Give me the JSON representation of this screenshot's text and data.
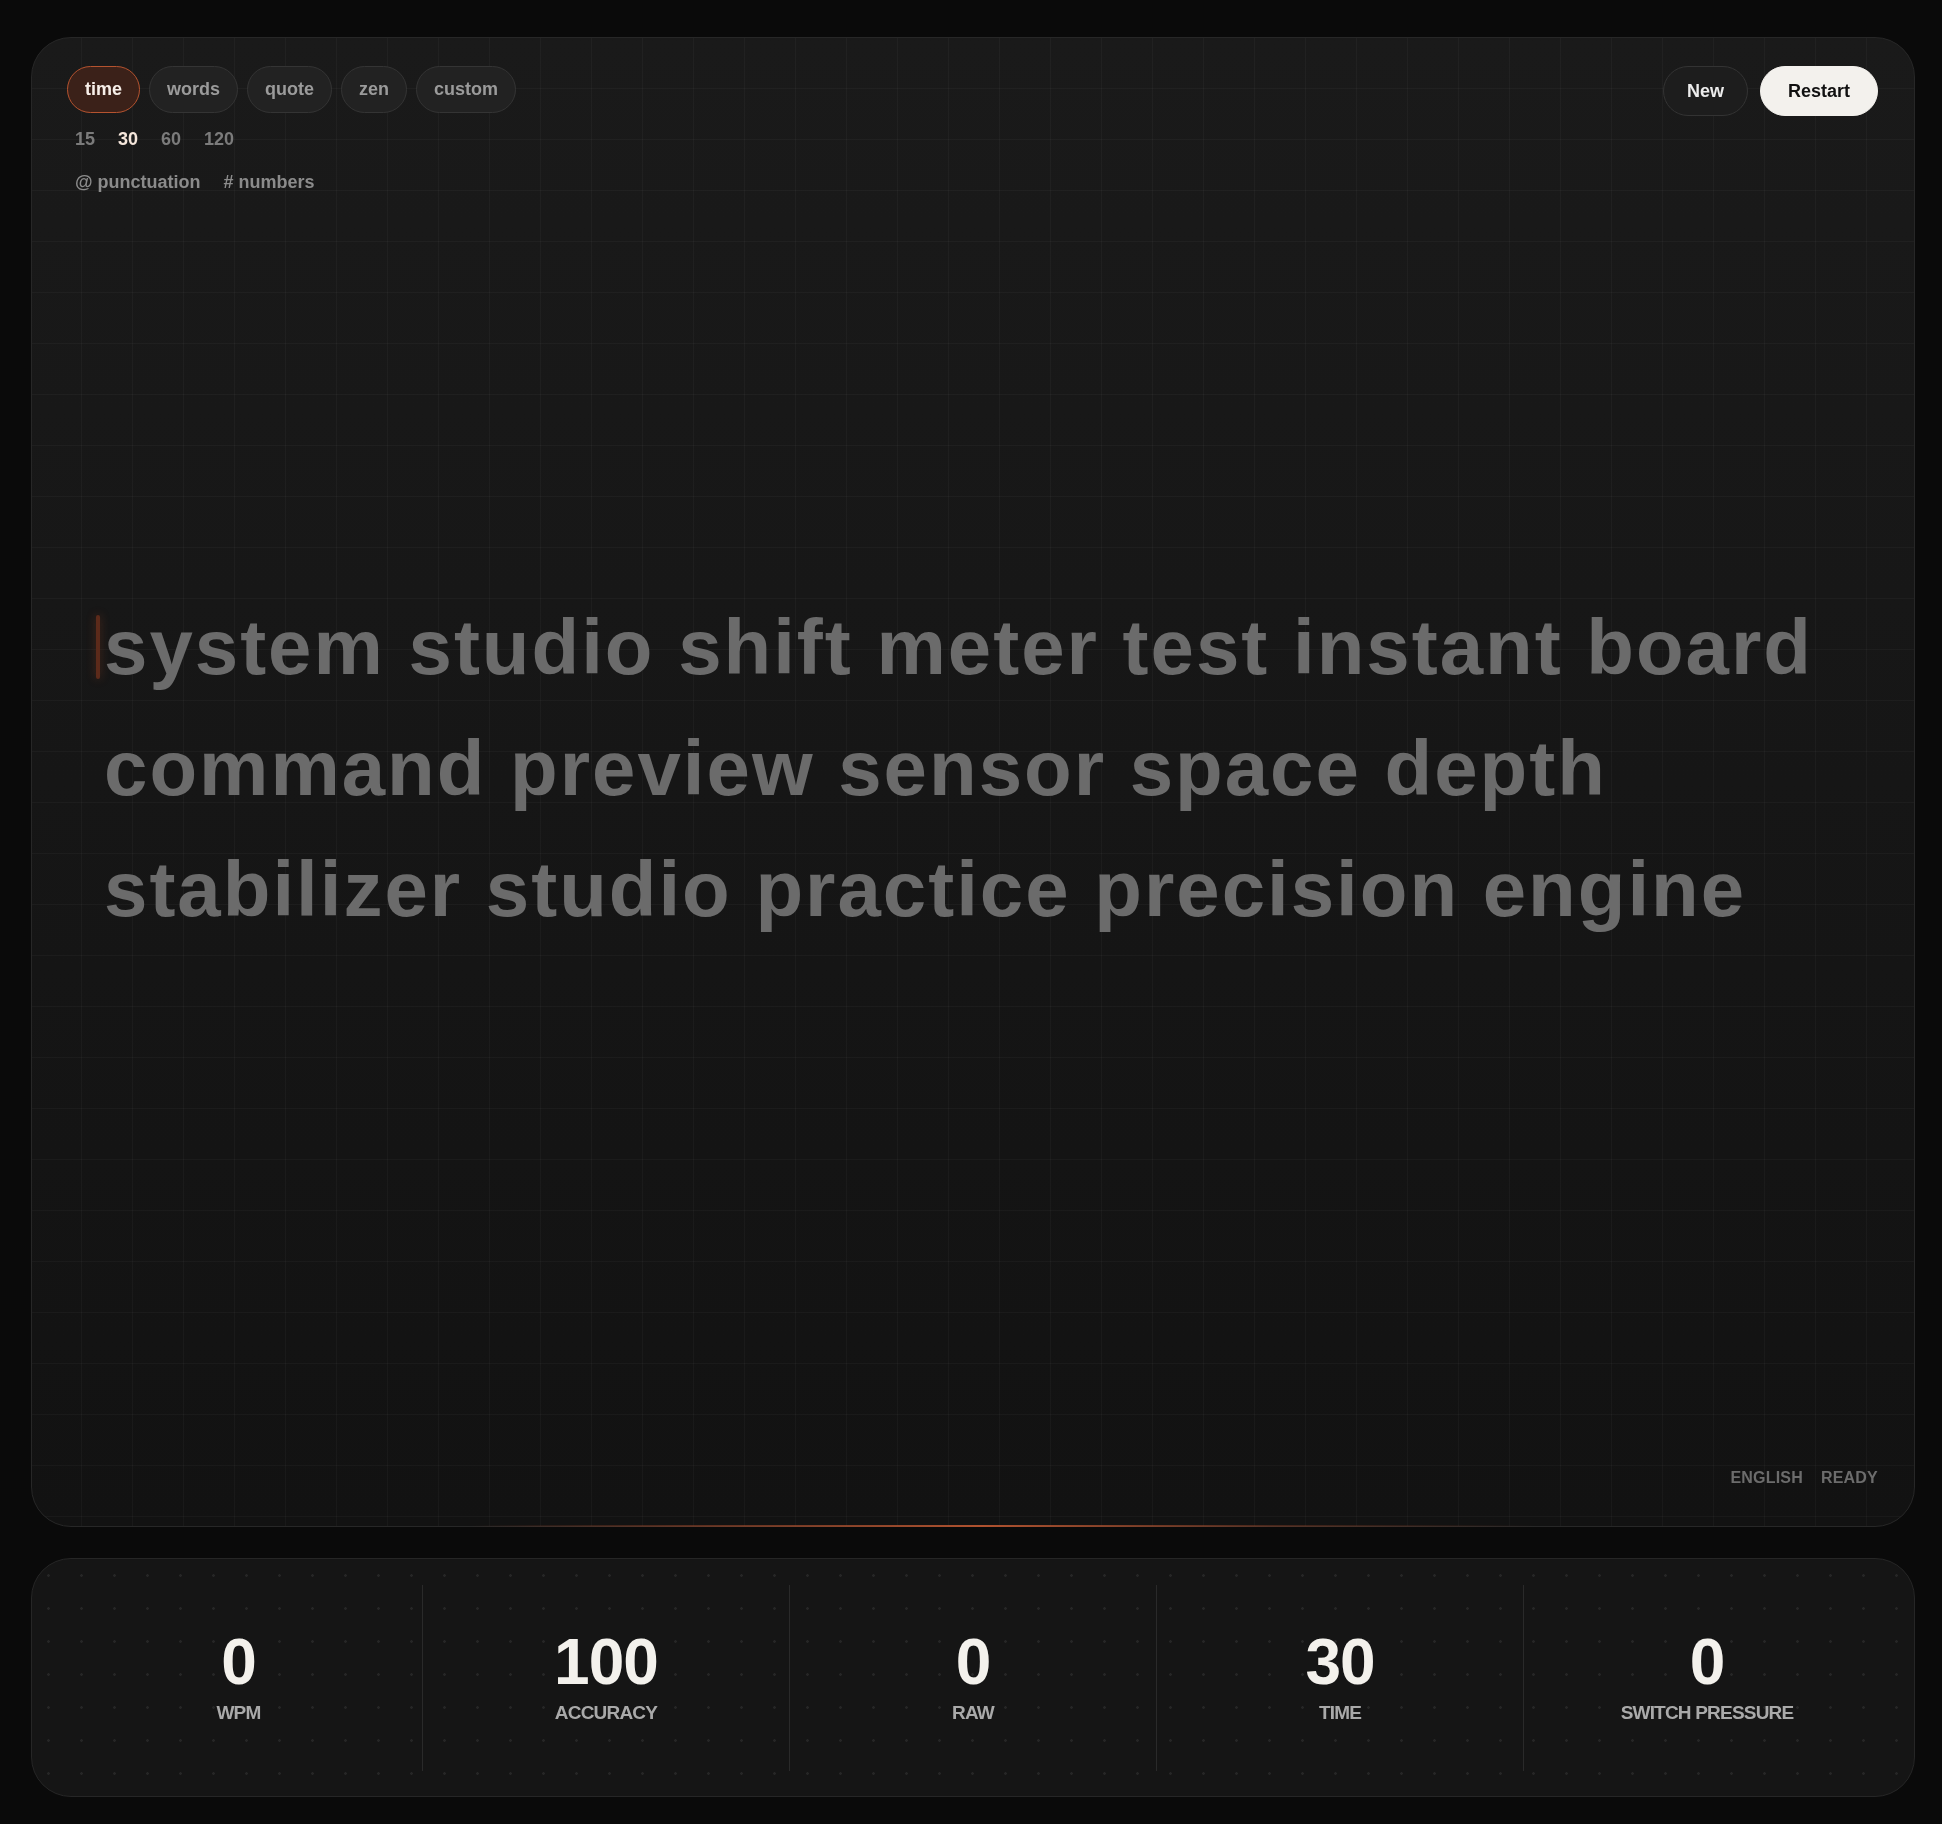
{
  "modes": [
    {
      "label": "time",
      "selected": true
    },
    {
      "label": "words",
      "selected": false
    },
    {
      "label": "quote",
      "selected": false
    },
    {
      "label": "zen",
      "selected": false
    },
    {
      "label": "custom",
      "selected": false
    }
  ],
  "durations": [
    {
      "label": "15",
      "selected": false
    },
    {
      "label": "30",
      "selected": true
    },
    {
      "label": "60",
      "selected": false
    },
    {
      "label": "120",
      "selected": false
    }
  ],
  "options": [
    "@ punctuation",
    "# numbers"
  ],
  "actions": [
    {
      "label": "New",
      "kind": "secondary"
    },
    {
      "label": "Restart",
      "kind": "primary"
    }
  ],
  "prompt": {
    "cursor": true,
    "lines": [
      "system studio shift meter test instant board",
      "command preview sensor space depth",
      "stabilizer studio practice precision engine"
    ]
  },
  "status": [
    "ENGLISH",
    "READY"
  ],
  "stats": [
    {
      "value": "0",
      "label": "WPM"
    },
    {
      "value": "100",
      "label": "ACCURACY"
    },
    {
      "value": "0",
      "label": "RAW"
    },
    {
      "value": "30",
      "label": "TIME"
    },
    {
      "value": "0",
      "label": "SWITCH PRESSURE"
    }
  ]
}
